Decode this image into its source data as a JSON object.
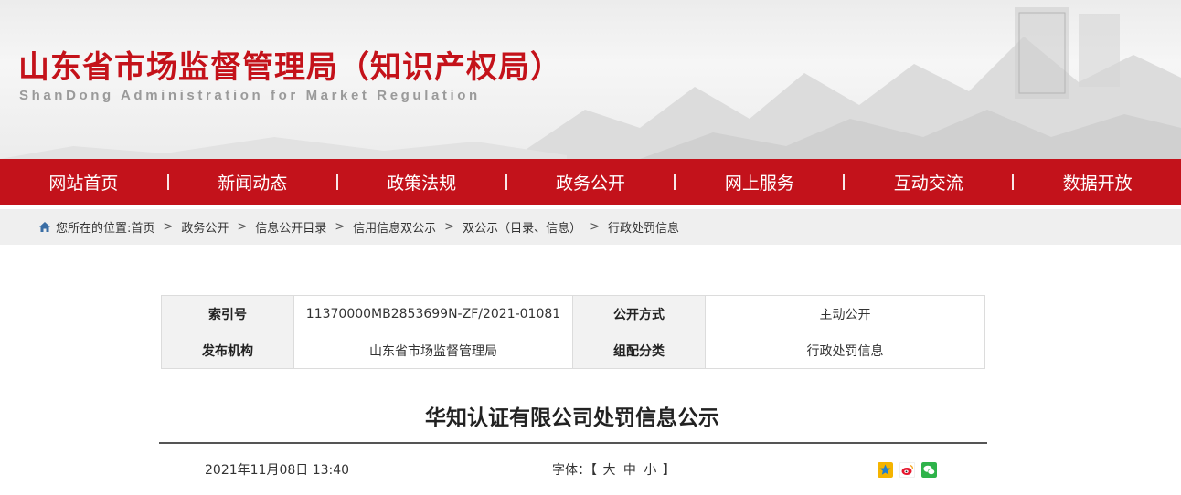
{
  "header": {
    "title": "山东省市场监督管理局（知识产权局）",
    "subtitle": "ShanDong Administration for Market Regulation"
  },
  "nav": {
    "items": [
      "网站首页",
      "新闻动态",
      "政策法规",
      "政务公开",
      "网上服务",
      "互动交流",
      "数据开放"
    ]
  },
  "breadcrumb": {
    "prefix": "您所在的位置:",
    "items": [
      "首页",
      "政务公开",
      "信息公开目录",
      "信用信息双公示",
      "双公示（目录、信息）",
      "行政处罚信息"
    ],
    "separator": ">"
  },
  "info": {
    "index_label": "索引号",
    "index_value": "11370000MB2853699N-ZF/2021-01081",
    "open_label": "公开方式",
    "open_value": "主动公开",
    "publisher_label": "发布机构",
    "publisher_value": "山东省市场监督管理局",
    "category_label": "组配分类",
    "category_value": "行政处罚信息"
  },
  "article": {
    "title": "华知认证有限公司处罚信息公示",
    "date": "2021年11月08日 13:40",
    "font_label": "字体：【",
    "font_large": "大",
    "font_medium": "中",
    "font_small": "小",
    "font_close": "】"
  },
  "share": {
    "icons": [
      "qzone-icon",
      "weibo-icon",
      "wechat-icon"
    ]
  },
  "colors": {
    "brand_red": "#c3121b",
    "title_red": "#c4121a"
  }
}
